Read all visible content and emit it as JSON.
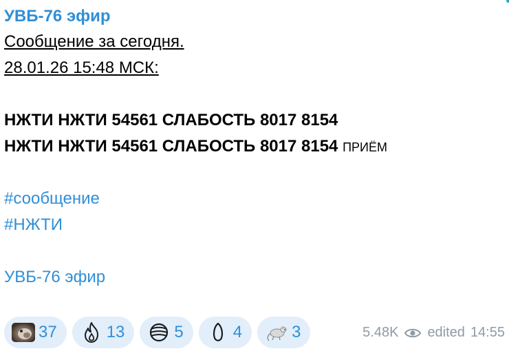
{
  "channel": {
    "title": "УВБ-76 эфир",
    "accent_color": "#2f8fd7"
  },
  "message": {
    "intro_line": "Сообщение за сегодня.",
    "date_line": "28.01.26 15:48 МСК:",
    "code_line_1": "НЖТИ НЖТИ 54561 СЛАБОСТЬ 8017 8154",
    "code_line_2": "НЖТИ НЖТИ 54561 СЛАБОСТЬ 8017 8154",
    "code_line_2_suffix": "ПРИЁМ",
    "hashtags": [
      "#сообщение",
      "#НЖТИ"
    ],
    "signature": "УВБ-76 эфир"
  },
  "reactions": [
    {
      "icon": "animal-photo-icon",
      "count": "37"
    },
    {
      "icon": "fire-outline-icon",
      "count": "13"
    },
    {
      "icon": "ball-icon",
      "count": "5"
    },
    {
      "icon": "seed-icon",
      "count": "4"
    },
    {
      "icon": "rat-icon",
      "count": "3"
    }
  ],
  "meta": {
    "views": "5.48K",
    "views_icon": "eye-icon",
    "edited_label": "edited",
    "time": "14:55"
  }
}
